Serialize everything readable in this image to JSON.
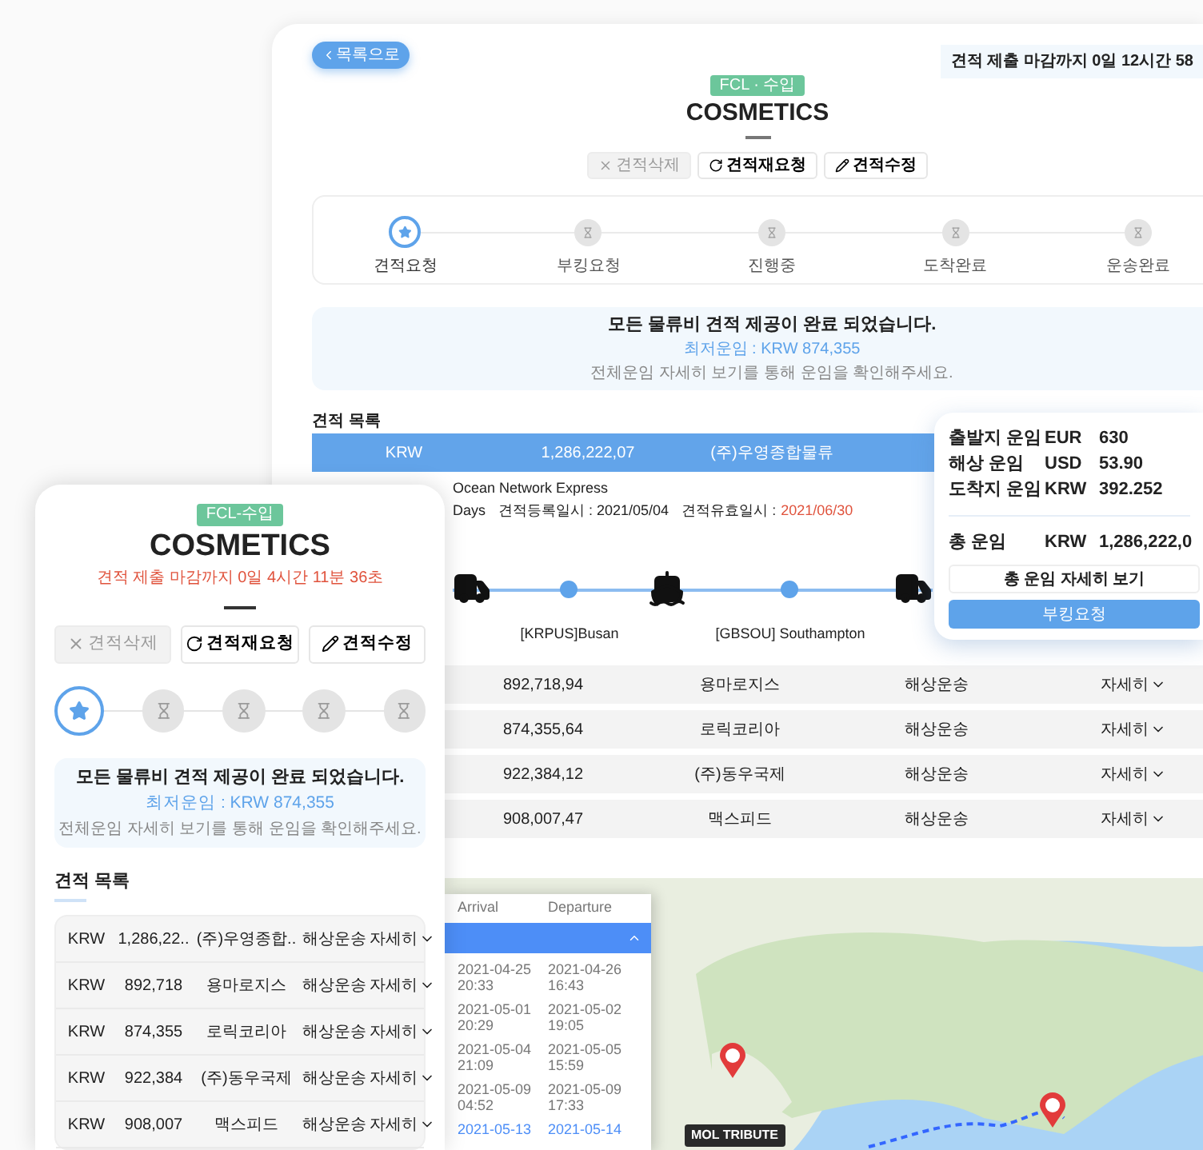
{
  "desktop": {
    "back_button": "목록으로",
    "deadline": "견적 제출 마감까지 0일 12시간 58",
    "badge": "FCL · 수입",
    "title": "COSMETICS",
    "actions": [
      {
        "kind": "delete",
        "label": "견적삭제",
        "disabled": true
      },
      {
        "kind": "rerequest",
        "label": "견적재요청",
        "disabled": false
      },
      {
        "kind": "edit",
        "label": "견적수정",
        "disabled": false
      }
    ],
    "steps": [
      {
        "label": "견적요청",
        "selected": true
      },
      {
        "label": "부킹요청",
        "selected": false
      },
      {
        "label": "진행중",
        "selected": false
      },
      {
        "label": "도착완료",
        "selected": false
      },
      {
        "label": "운송완료",
        "selected": false
      }
    ],
    "notice": {
      "title": "모든 물류비 견적 제공이 완료 되었습니다.",
      "lowest": "최저운임 : KRW 874,355",
      "hint": "전체운임 자세히 보기를 통해 운임을 확인해주세요."
    },
    "list_title": "견적 목록",
    "quotes": [
      {
        "currency": "KRW",
        "amount": "1,286,222,07",
        "company": "(주)우영종합물류",
        "expanded": true,
        "info": {
          "carrier": "Ocean Network Express",
          "transit": "Days",
          "registered": "견적등록일시 : 2021/05/04",
          "valid_label": "견적유효일시 :",
          "valid_date": "2021/06/30",
          "route": [
            {
              "kind": "truck"
            },
            {
              "kind": "port",
              "label": "[KRPUS]Busan"
            },
            {
              "kind": "ship"
            },
            {
              "kind": "port",
              "label": "[GBSOU] Southampton"
            },
            {
              "kind": "truck"
            }
          ]
        }
      },
      {
        "amount": "892,718,94",
        "company": "용마로지스",
        "mode": "해상운송",
        "detail": "자세히",
        "expanded": false
      },
      {
        "amount": "874,355,64",
        "company": "로릭코리아",
        "mode": "해상운송",
        "detail": "자세히",
        "expanded": false
      },
      {
        "amount": "922,384,12",
        "company": "(주)동우국제",
        "mode": "해상운송",
        "detail": "자세히",
        "expanded": false
      },
      {
        "amount": "908,007,47",
        "company": "맥스피드",
        "mode": "해상운송",
        "detail": "자세히",
        "expanded": false
      }
    ],
    "schedule": {
      "columns": [
        "Arrival",
        "Departure"
      ],
      "rows": [
        {
          "arrival_date": "2021-04-25",
          "arrival_time": "20:33",
          "departure_date": "2021-04-26",
          "departure_time": "16:43",
          "selected": false
        },
        {
          "arrival_date": "2021-05-01",
          "arrival_time": "20:29",
          "departure_date": "2021-05-02",
          "departure_time": "19:05",
          "selected": false
        },
        {
          "arrival_date": "2021-05-04",
          "arrival_time": "21:09",
          "departure_date": "2021-05-05",
          "departure_time": "15:59",
          "selected": false
        },
        {
          "arrival_date": "2021-05-09",
          "arrival_time": "04:52",
          "departure_date": "2021-05-09",
          "departure_time": "17:33",
          "selected": false
        },
        {
          "arrival_date": "2021-05-13",
          "departure_date": "2021-05-14",
          "selected": true
        }
      ]
    },
    "vessel_label": "MOL TRIBUTE"
  },
  "popup": {
    "lines": [
      {
        "label": "출발지 운임",
        "currency": "EUR",
        "value": "630"
      },
      {
        "label": "해상 운임",
        "currency": "USD",
        "value": "53.90"
      },
      {
        "label": "도착지 운임",
        "currency": "KRW",
        "value": "392.252"
      }
    ],
    "total": {
      "label": "총 운임",
      "currency": "KRW",
      "value": "1,286,222,0"
    },
    "detail_button": "총 운임 자세히 보기",
    "book_button": "부킹요청"
  },
  "mobile": {
    "badge": "FCL-수입",
    "title": "COSMETICS",
    "deadline": "견적 제출 마감까지 0일 4시간 11분 36초",
    "actions": [
      {
        "kind": "delete",
        "label": "견적삭제",
        "disabled": true
      },
      {
        "kind": "rerequest",
        "label": "견적재요청",
        "disabled": false
      },
      {
        "kind": "edit",
        "label": "견적수정",
        "disabled": false
      }
    ],
    "steps": [
      {
        "selected": true
      },
      {
        "selected": false
      },
      {
        "selected": false
      },
      {
        "selected": false
      },
      {
        "selected": false
      }
    ],
    "notice": {
      "title": "모든 물류비 견적 제공이 완료 되었습니다.",
      "lowest": "최저운임 : KRW 874,355",
      "hint": "전체운임 자세히 보기를 통해 운임을 확인해주세요."
    },
    "list_title": "견적 목록",
    "quotes": [
      {
        "currency": "KRW",
        "amount": "1,286,22..",
        "company": "(주)우영종합..",
        "mode": "해상운송",
        "detail": "자세히"
      },
      {
        "currency": "KRW",
        "amount": "892,718",
        "company": "용마로지스",
        "mode": "해상운송",
        "detail": "자세히"
      },
      {
        "currency": "KRW",
        "amount": "874,355",
        "company": "로릭코리아",
        "mode": "해상운송",
        "detail": "자세히"
      },
      {
        "currency": "KRW",
        "amount": "922,384",
        "company": "(주)동우국제",
        "mode": "해상운송",
        "detail": "자세히"
      },
      {
        "currency": "KRW",
        "amount": "908,007",
        "company": "맥스피드",
        "mode": "해상운송",
        "detail": "자세히"
      }
    ]
  }
}
